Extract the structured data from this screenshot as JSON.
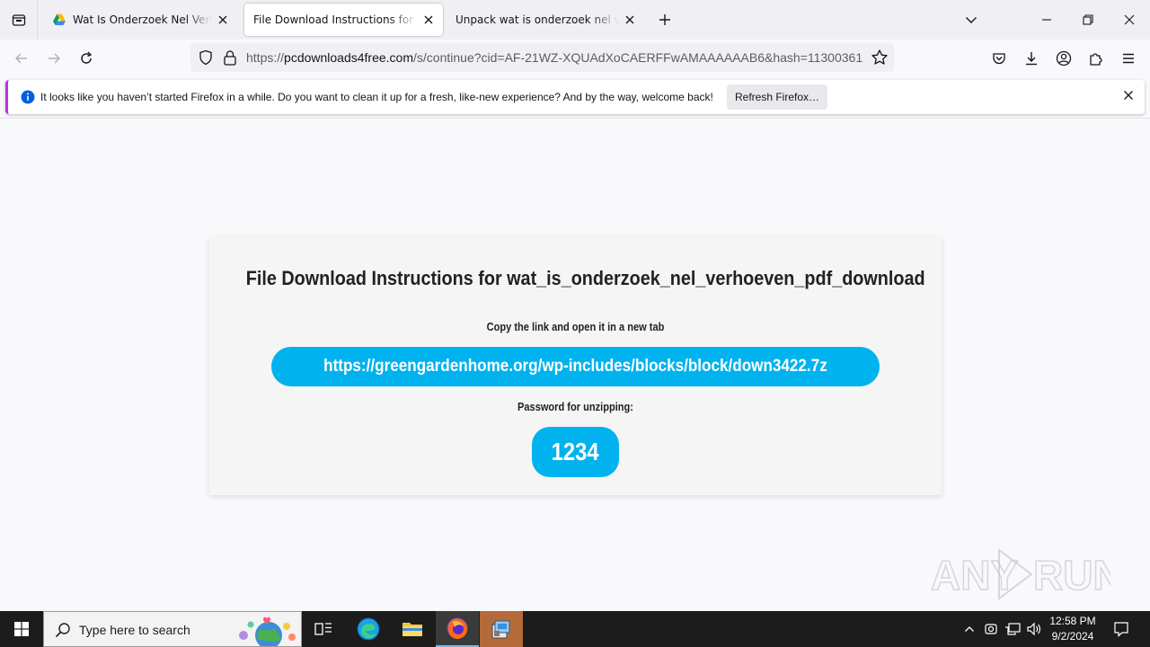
{
  "browser": {
    "tabs": [
      {
        "title": "Wat Is Onderzoek Nel Verhoeven",
        "favicon": "google-drive-icon",
        "active": false
      },
      {
        "title": "File Download Instructions for wat_is",
        "favicon": "",
        "active": true
      },
      {
        "title": "Unpack wat is onderzoek nel verhoeven",
        "favicon": "",
        "active": false
      }
    ],
    "url": {
      "scheme": "https://",
      "host": "pcdownloads4free.com",
      "path": "/s/continue?cid=AF-21WZ-XQUAdXoCAERFFwAMAAAAAAB6&hash=11300361"
    }
  },
  "notification": {
    "message": "It looks like you haven’t started Firefox in a while. Do you want to clean it up for a fresh, like-new experience? And by the way, welcome back!",
    "button": "Refresh Firefox…"
  },
  "page": {
    "title": "File Download Instructions for wat_is_onderzoek_nel_verhoeven_pdf_download",
    "link_instruction": "Copy the link and open it in a new tab",
    "download_link": "https://greengardenhome.org/wp-includes/blocks/block/down3422.7z",
    "password_label": "Password for unzipping:",
    "password": "1234"
  },
  "watermark": {
    "text": "ANY RUN"
  },
  "taskbar": {
    "search_placeholder": "Type here to search",
    "time": "12:58 PM",
    "date": "9/2/2024"
  },
  "colors": {
    "accent": "#00b2ee",
    "taskbar": "#1c1c1c",
    "notification_stripe": "#b833e1",
    "info_blue": "#0060df"
  }
}
